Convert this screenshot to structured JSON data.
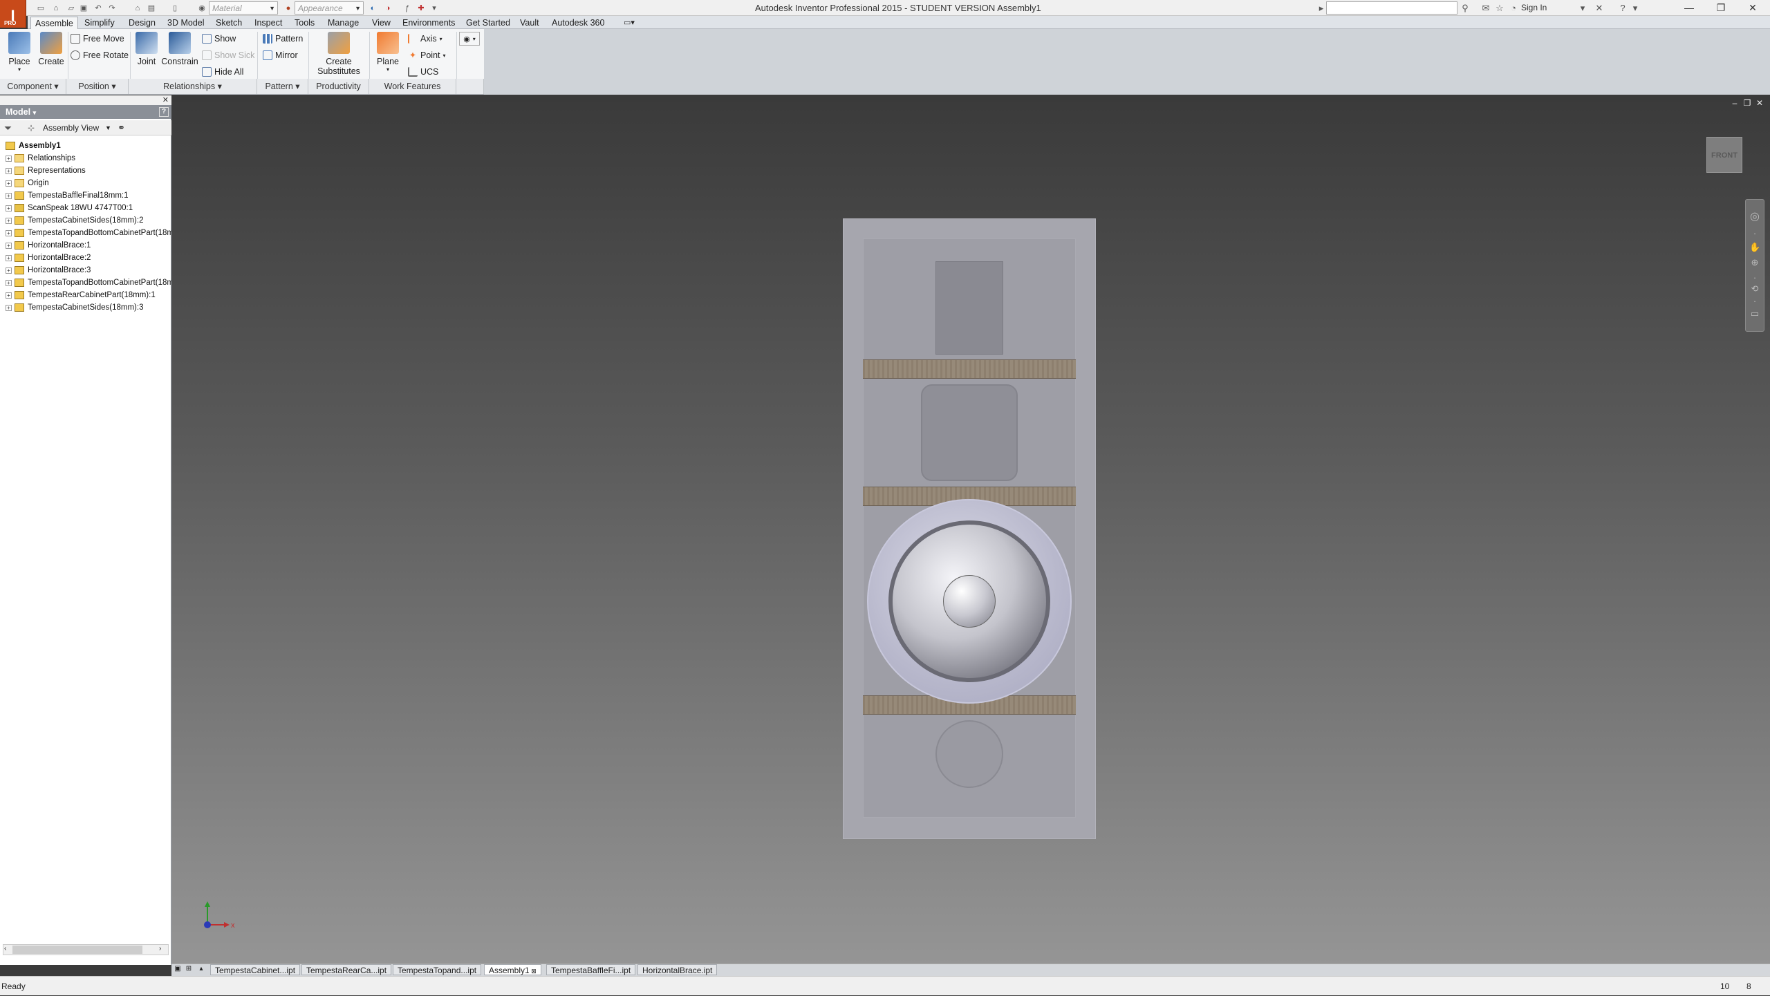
{
  "app": {
    "logo": "I",
    "logo_sub": "PRO",
    "window_title": "Autodesk Inventor Professional 2015 - STUDENT VERSION    Assembly1",
    "material_placeholder": "Material",
    "appearance_placeholder": "Appearance",
    "sign_in": "Sign In"
  },
  "tabs": [
    "Assemble",
    "Simplify",
    "Design",
    "3D Model",
    "Sketch",
    "Inspect",
    "Tools",
    "Manage",
    "View",
    "Environments",
    "Get Started",
    "Vault",
    "Autodesk 360"
  ],
  "ribbon": {
    "place": "Place",
    "create": "Create",
    "free_move": "Free Move",
    "free_rotate": "Free Rotate",
    "joint": "Joint",
    "constrain": "Constrain",
    "show": "Show",
    "show_sick": "Show Sick",
    "hide_all": "Hide All",
    "pattern": "Pattern",
    "mirror": "Mirror",
    "create_substitutes_1": "Create",
    "create_substitutes_2": "Substitutes",
    "plane": "Plane",
    "axis": "Axis",
    "point": "Point",
    "ucs": "UCS",
    "panels": {
      "component": "Component",
      "position": "Position",
      "relationships": "Relationships",
      "pattern": "Pattern",
      "productivity": "Productivity",
      "work_features": "Work Features"
    }
  },
  "browser": {
    "title": "Model",
    "view": "Assembly View",
    "root": "Assembly1",
    "items": [
      {
        "label": "Relationships",
        "kind": "folder"
      },
      {
        "label": "Representations",
        "kind": "folder"
      },
      {
        "label": "Origin",
        "kind": "folder"
      },
      {
        "label": "TempestaBaffleFinal18mm:1",
        "kind": "part"
      },
      {
        "label": "ScanSpeak 18WU 4747T00:1",
        "kind": "sub"
      },
      {
        "label": "TempestaCabinetSides(18mm):2",
        "kind": "part"
      },
      {
        "label": "TempestaTopandBottomCabinetPart(18m",
        "kind": "part"
      },
      {
        "label": "HorizontalBrace:1",
        "kind": "part"
      },
      {
        "label": "HorizontalBrace:2",
        "kind": "part"
      },
      {
        "label": "HorizontalBrace:3",
        "kind": "part"
      },
      {
        "label": "TempestaTopandBottomCabinetPart(18m",
        "kind": "part"
      },
      {
        "label": "TempestaRearCabinetPart(18mm):1",
        "kind": "part"
      },
      {
        "label": "TempestaCabinetSides(18mm):3",
        "kind": "part"
      }
    ]
  },
  "viewport": {
    "viewcube_label": "FRONT",
    "axis_x": "x"
  },
  "doc_tabs": [
    {
      "label": "TempestaCabinet...ipt",
      "active": false
    },
    {
      "label": "TempestaRearCa...ipt",
      "active": false
    },
    {
      "label": "TempestaTopand...ipt",
      "active": false
    },
    {
      "label": "Assembly1",
      "active": true
    },
    {
      "label": "TempestaBaffleFi...ipt",
      "active": false
    },
    {
      "label": "HorizontalBrace.ipt",
      "active": false
    }
  ],
  "status": {
    "text": "Ready",
    "count1": "10",
    "count2": "8"
  }
}
